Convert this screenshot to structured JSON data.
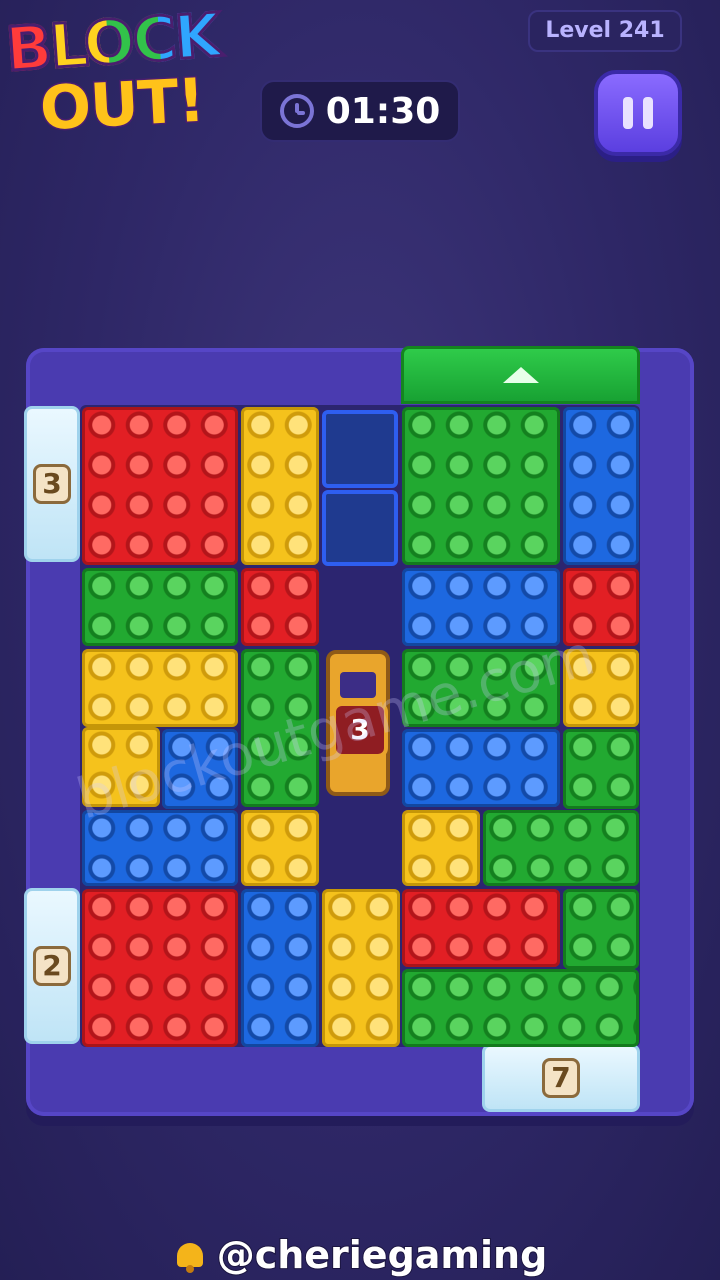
{
  "logo": {
    "line1": "BLOCK",
    "line2": "OUT!"
  },
  "level": {
    "label": "Level 241"
  },
  "timer": {
    "value": "01:30",
    "icon": "clock-icon"
  },
  "pause": {
    "icon": "pause-icon"
  },
  "board": {
    "exit_icon": "arrow-up-icon",
    "gates": [
      {
        "id": "gate-left-top",
        "count": "3",
        "color": "ice"
      },
      {
        "id": "gate-left-bottom",
        "count": "2",
        "color": "ice"
      },
      {
        "id": "gate-bottom-right",
        "count": "7",
        "color": "ice"
      }
    ],
    "lock": {
      "count": "3"
    },
    "colors": {
      "red": "#e21f24",
      "yellow": "#f5c21c",
      "green": "#22a931",
      "blue": "#1d68e0"
    }
  },
  "watermark": "blockoutgame.com",
  "footer": {
    "handle": "@cheriegaming",
    "icon": "bell-icon"
  }
}
